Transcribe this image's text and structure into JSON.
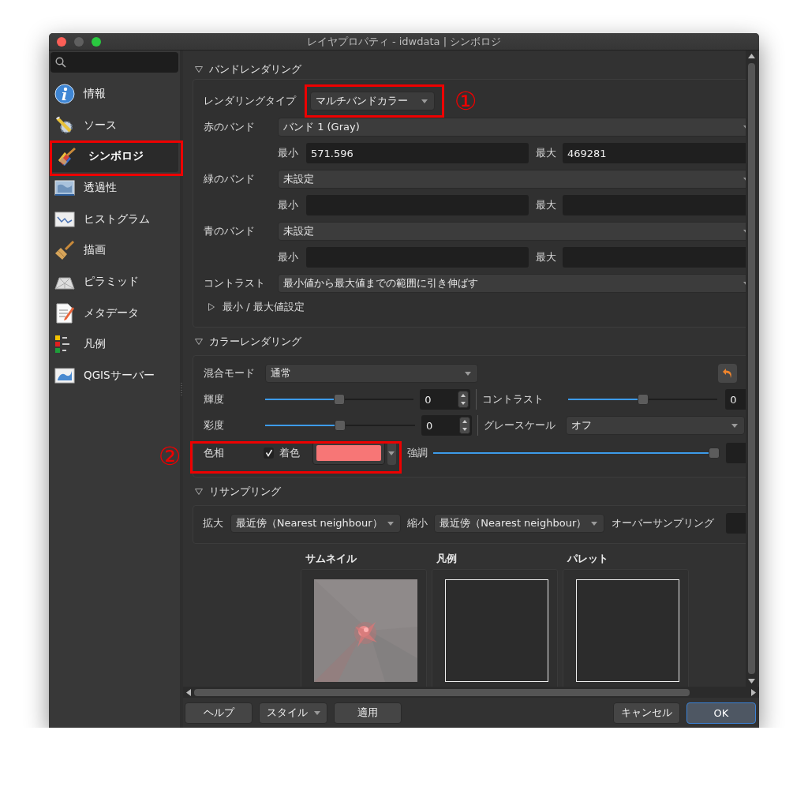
{
  "window": {
    "title": "レイヤプロパティ - idwdata | シンボロジ"
  },
  "sidebar": {
    "items": [
      {
        "label": "情報",
        "selected": false
      },
      {
        "label": "ソース",
        "selected": false
      },
      {
        "label": "シンボロジ",
        "selected": true
      },
      {
        "label": "透過性",
        "selected": false
      },
      {
        "label": "ヒストグラム",
        "selected": false
      },
      {
        "label": "描画",
        "selected": false
      },
      {
        "label": "ピラミッド",
        "selected": false
      },
      {
        "label": "メタデータ",
        "selected": false
      },
      {
        "label": "凡例",
        "selected": false
      },
      {
        "label": "QGISサーバー",
        "selected": false
      }
    ]
  },
  "band_rendering": {
    "title": "バンドレンダリング",
    "expanded": true,
    "render_type": {
      "label": "レンダリングタイプ",
      "value": "マルチバンドカラー"
    },
    "bands": [
      {
        "label": "赤のバンド",
        "value": "バンド 1 (Gray)",
        "min_label": "最小",
        "min": "571.596",
        "max_label": "最大",
        "max": "469281"
      },
      {
        "label": "緑のバンド",
        "value": "未設定",
        "min_label": "最小",
        "max_label": "最大"
      },
      {
        "label": "青のバンド",
        "value": "未設定",
        "min_label": "最小",
        "max_label": "最大"
      }
    ],
    "contrast": {
      "label": "コントラスト",
      "value": "最小値から最大値までの範囲に引き伸ばす"
    },
    "minmax": {
      "label": "最小 / 最大値設定",
      "expanded": false
    }
  },
  "color_rendering": {
    "title": "カラーレンダリング",
    "expanded": true,
    "blend": {
      "label": "混合モード",
      "value": "通常"
    },
    "brightness": {
      "label": "輝度",
      "level": 0.5,
      "value": "0"
    },
    "contrast": {
      "label": "コントラスト",
      "level": 0.5,
      "value": "0"
    },
    "saturation": {
      "label": "彩度",
      "level": 0.5,
      "value": "0"
    },
    "grayscale": {
      "label": "グレースケール",
      "value": "オフ"
    },
    "hue": {
      "label": "色相"
    },
    "colorize": {
      "label": "着色",
      "checked": true,
      "color": "#f77676"
    },
    "strength": {
      "label": "強調",
      "level": 1
    }
  },
  "resampling": {
    "title": "リサンプリング",
    "expanded": true,
    "zoom_in": {
      "label": "拡大",
      "value": "最近傍（Nearest neighbour）"
    },
    "zoom_out": {
      "label": "縮小",
      "value": "最近傍（Nearest neighbour）"
    },
    "oversampling": {
      "label": "オーバーサンプリング"
    }
  },
  "previews": [
    {
      "label": "サムネイル",
      "kind": "picture"
    },
    {
      "label": "凡例",
      "kind": "empty"
    },
    {
      "label": "パレット",
      "kind": "empty"
    }
  ],
  "buttons": [
    {
      "label": "ヘルプ",
      "kind": "plain"
    },
    {
      "label": "スタイル",
      "kind": "menu"
    },
    {
      "label": "適用",
      "kind": "plain"
    },
    {
      "label": "キャンセル",
      "kind": "plain"
    },
    {
      "label": "OK",
      "kind": "default"
    }
  ],
  "annotations": [
    {
      "label": "①"
    },
    {
      "label": "②"
    }
  ]
}
